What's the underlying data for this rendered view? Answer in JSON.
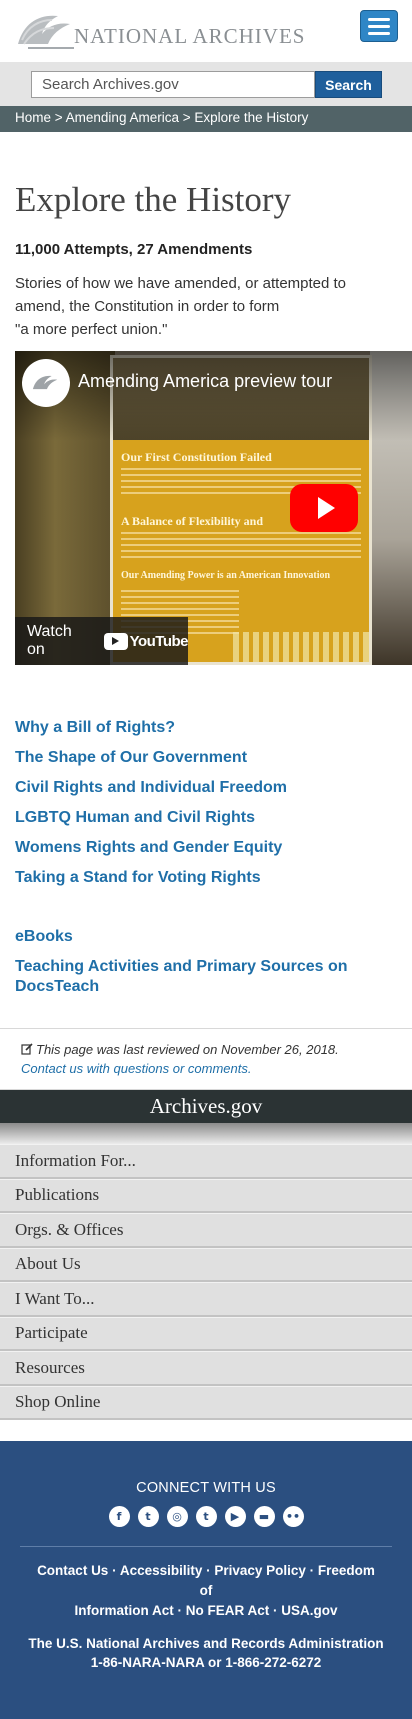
{
  "header": {
    "logo_text": "NATIONAL ARCHIVES"
  },
  "search": {
    "placeholder": "Search Archives.gov",
    "button_label": "Search"
  },
  "breadcrumb": {
    "items": [
      "Home",
      "Amending America",
      "Explore the History"
    ],
    "separator": " > "
  },
  "main": {
    "title": "Explore the History",
    "subtitle": "11,000 Attempts, 27 Amendments",
    "intro_lines": [
      "Stories of how we have amended, or attempted to",
      "amend, the Constitution in order to form",
      "\"a more perfect union.\""
    ]
  },
  "video": {
    "title": "Amending America preview tour",
    "channel_avatar_text": "NATIONAL ARCHIVES",
    "poster_headings": [
      "Our First Constitution Failed",
      "A Balance of Flexibility and",
      "Our Amending Power is an American Innovation"
    ],
    "watch_on": "Watch on",
    "youtube": "YouTube"
  },
  "topic_links": [
    "Why a Bill of Rights?",
    "The Shape of Our Government",
    "Civil Rights and Individual Freedom",
    "LGBTQ Human and Civil Rights",
    "Womens Rights and Gender Equity",
    "Taking a Stand for Voting Rights"
  ],
  "extra_links": [
    "eBooks",
    "Teaching Activities and Primary Sources on DocsTeach"
  ],
  "review": {
    "text": "This page was last reviewed on November 26, 2018.",
    "contact": "Contact us with questions or comments."
  },
  "archives_band": "Archives.gov",
  "nav_items": [
    "Information For...",
    "Publications",
    "Orgs. & Offices",
    "About Us",
    "I Want To...",
    "Participate",
    "Resources",
    "Shop Online"
  ],
  "footer": {
    "connect": "CONNECT WITH US",
    "socials": [
      {
        "name": "facebook",
        "glyph": "f"
      },
      {
        "name": "twitter",
        "glyph": "t"
      },
      {
        "name": "instagram",
        "glyph": "◎"
      },
      {
        "name": "tumblr",
        "glyph": "t"
      },
      {
        "name": "youtube",
        "glyph": "▶"
      },
      {
        "name": "blogs",
        "glyph": "▬"
      },
      {
        "name": "flickr",
        "glyph": "••"
      }
    ],
    "links_line1": "Contact Us · Accessibility · Privacy Policy · Freedom of",
    "links_line2": "Information Act · No FEAR Act · USA.gov",
    "org_name": "The U.S. National Archives and Records Administration",
    "phone": "1-86-NARA-NARA or 1-866-272-6272"
  },
  "colors": {
    "link_blue": "#1f6fa8",
    "breadcrumb_bg": "#516367",
    "footer_bg": "#2b4f80",
    "menu_button": "#2f86c6",
    "youtube_red": "#ff0000"
  }
}
